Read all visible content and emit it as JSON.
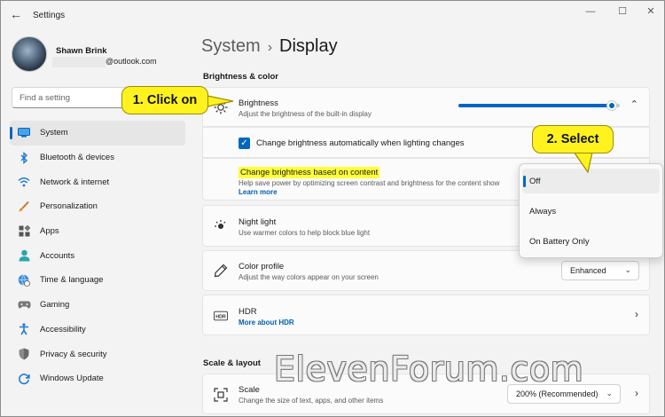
{
  "window": {
    "title": "Settings",
    "back": "←",
    "minimize": "—",
    "maximize": "☐",
    "close": "✕"
  },
  "user": {
    "name": "Shawn Brink",
    "email": "@outlook.com"
  },
  "search": {
    "placeholder": "Find a setting"
  },
  "nav": [
    {
      "label": "System",
      "icon": "monitor-icon",
      "active": true
    },
    {
      "label": "Bluetooth & devices",
      "icon": "bluetooth-icon"
    },
    {
      "label": "Network & internet",
      "icon": "wifi-icon"
    },
    {
      "label": "Personalization",
      "icon": "brush-icon"
    },
    {
      "label": "Apps",
      "icon": "apps-icon"
    },
    {
      "label": "Accounts",
      "icon": "person-icon"
    },
    {
      "label": "Time & language",
      "icon": "globe-clock-icon"
    },
    {
      "label": "Gaming",
      "icon": "gamepad-icon"
    },
    {
      "label": "Accessibility",
      "icon": "accessibility-icon"
    },
    {
      "label": "Privacy & security",
      "icon": "shield-icon"
    },
    {
      "label": "Windows Update",
      "icon": "update-icon"
    }
  ],
  "breadcrumb": {
    "parent": "System",
    "separator": "›",
    "current": "Display"
  },
  "sections": {
    "brightness_color": "Brightness & color",
    "scale_layout": "Scale & layout"
  },
  "brightness": {
    "title": "Brightness",
    "subtitle": "Adjust the brightness of the built-in display",
    "level": 0.98,
    "chevron": "⌃"
  },
  "auto_brightness": {
    "label": "Change brightness automatically when lighting changes",
    "checked": true
  },
  "content_brightness": {
    "title": "Change brightness based on content",
    "subtitle": "Help save power by optimizing screen contrast and brightness for the content show",
    "link": "Learn more"
  },
  "night_light": {
    "title": "Night light",
    "subtitle": "Use warmer colors to help block blue light"
  },
  "color_profile": {
    "title": "Color profile",
    "subtitle": "Adjust the way colors appear on your screen",
    "value": "Enhanced"
  },
  "hdr": {
    "title": "HDR",
    "link": "More about HDR",
    "icon_text": "HDR"
  },
  "scale": {
    "title": "Scale",
    "subtitle": "Change the size of text, apps, and other items",
    "value": "200% (Recommended)"
  },
  "flyout": {
    "options": [
      "Off",
      "Always",
      "On Battery Only"
    ],
    "selected": "Off"
  },
  "callouts": {
    "step1": "1. Click on",
    "step2": "2. Select"
  },
  "watermark": "ElevenForum.com",
  "colors": {
    "accent": "#0067c0",
    "callout": "#fff21f",
    "highlight": "#ffff3b"
  }
}
